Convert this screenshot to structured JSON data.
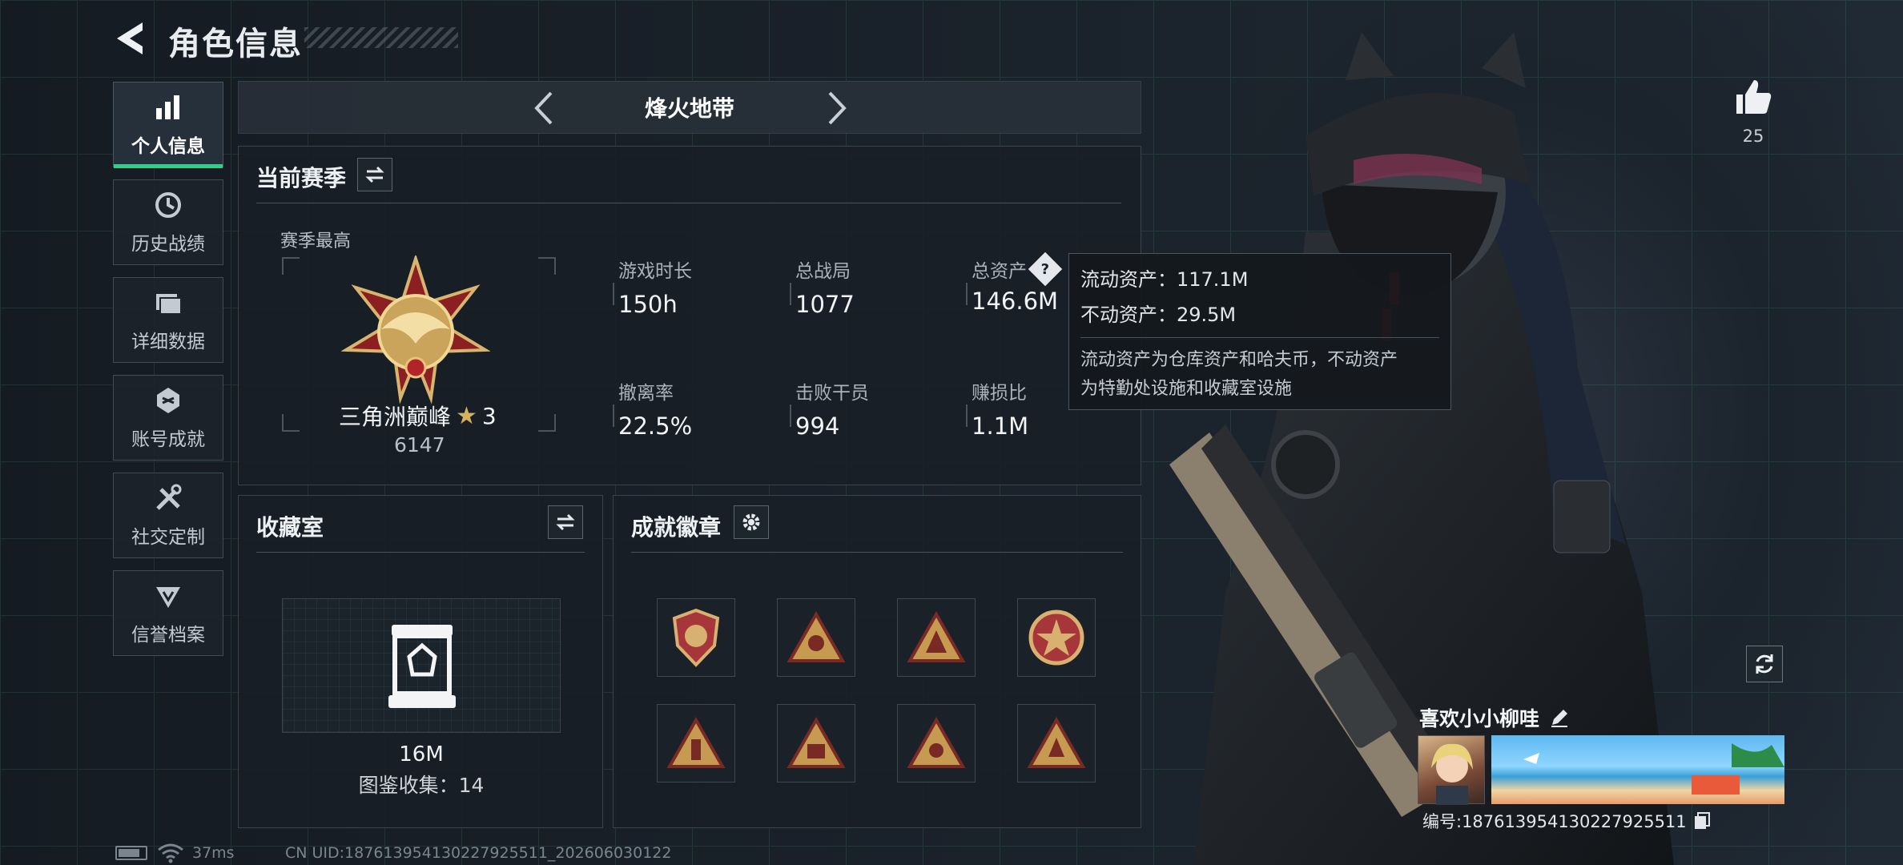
{
  "header": {
    "title": "角色信息"
  },
  "nav": [
    {
      "label": "个人信息",
      "icon": "bar-chart-icon",
      "active": true
    },
    {
      "label": "历史战绩",
      "icon": "history-clock-icon"
    },
    {
      "label": "详细数据",
      "icon": "folder-data-icon"
    },
    {
      "label": "账号成就",
      "icon": "achievement-icon"
    },
    {
      "label": "社交定制",
      "icon": "wrench-tools-icon"
    },
    {
      "label": "信誉档案",
      "icon": "reputation-icon"
    }
  ],
  "mode": {
    "name": "烽火地带"
  },
  "season": {
    "title": "当前赛季",
    "best_label": "赛季最高",
    "rank_name": "三角洲巅峰",
    "rank_stars": "3",
    "rank_score": "6147",
    "stats": [
      {
        "label": "游戏时长",
        "value": "150h"
      },
      {
        "label": "总战局",
        "value": "1077"
      },
      {
        "label": "总资产",
        "value": "146.6M"
      },
      {
        "label": "撤离率",
        "value": "22.5%"
      },
      {
        "label": "击败干员",
        "value": "994"
      },
      {
        "label": "赚损比",
        "value": "1.1M"
      }
    ]
  },
  "tooltip": {
    "liquid": "流动资产：117.1M",
    "fixed": "不动资产：29.5M",
    "desc1": "流动资产为仓库资产和哈夫币，不动资产",
    "desc2": "为特勤处设施和收藏室设施"
  },
  "collection": {
    "title": "收藏室",
    "value": "16M",
    "catalog": "图鉴收集：14"
  },
  "badges": {
    "title": "成就徽章",
    "count": 8
  },
  "like": {
    "count": "25"
  },
  "player": {
    "name": "喜欢小小柳哇",
    "id": "编号:187613954130227925511"
  },
  "status": {
    "ping": "37ms",
    "uid": "CN UID:187613954130227925511_202606030122"
  },
  "colors": {
    "accent": "#2fd08a",
    "gold": "#c9a45a",
    "red": "#8c1f22"
  }
}
